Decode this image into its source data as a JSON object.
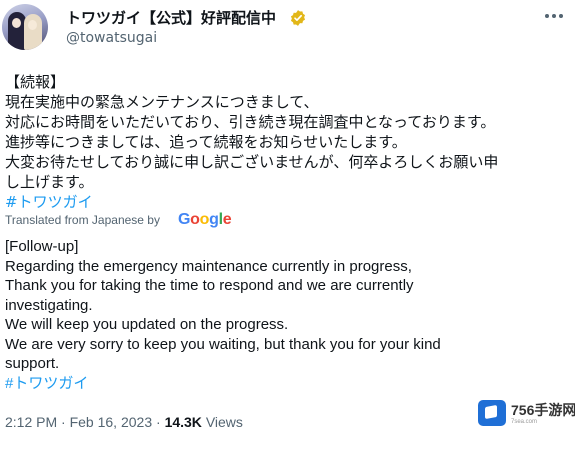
{
  "account": {
    "display_name": "トワツガイ【公式】好評配信中",
    "handle": "@towatsugai",
    "verified_color": "#e2b719"
  },
  "tweet": {
    "japanese_lines": [
      "【続報】",
      "現在実施中の緊急メンテナンスにつきまして、",
      "対応にお時間をいただいており、引き続き現在調査中となっております。",
      "進捗等につきましては、追って続報をお知らせいたします。",
      "大変お待たせしており誠に申し訳ございませんが、何卒よろしくお願い申",
      "し上げます。"
    ],
    "hashtag_jp": "#トワツガイ",
    "translated_label": "Translated from Japanese by",
    "translation_provider": "Google",
    "english_lines": [
      "[Follow-up]",
      "Regarding the emergency maintenance currently in progress,",
      "Thank you for taking the time to respond and we are currently",
      "investigating.",
      "We will keep you updated on the progress.",
      "We are very sorry to keep you waiting, but thank you for your kind",
      "support."
    ],
    "hashtag_en": "#トワツガイ"
  },
  "meta": {
    "time": "2:12 PM",
    "separator": "·",
    "date": "Feb 16, 2023",
    "views_count": "14.3K",
    "views_label": "Views"
  },
  "watermark": {
    "text": "756手游网",
    "sub": "7sea.com"
  },
  "icons": {
    "more": "more-options-icon",
    "verified": "verified-badge-icon"
  },
  "colors": {
    "link": "#1d9bf0",
    "secondary_text": "#536471",
    "primary_text": "#0f1419"
  }
}
